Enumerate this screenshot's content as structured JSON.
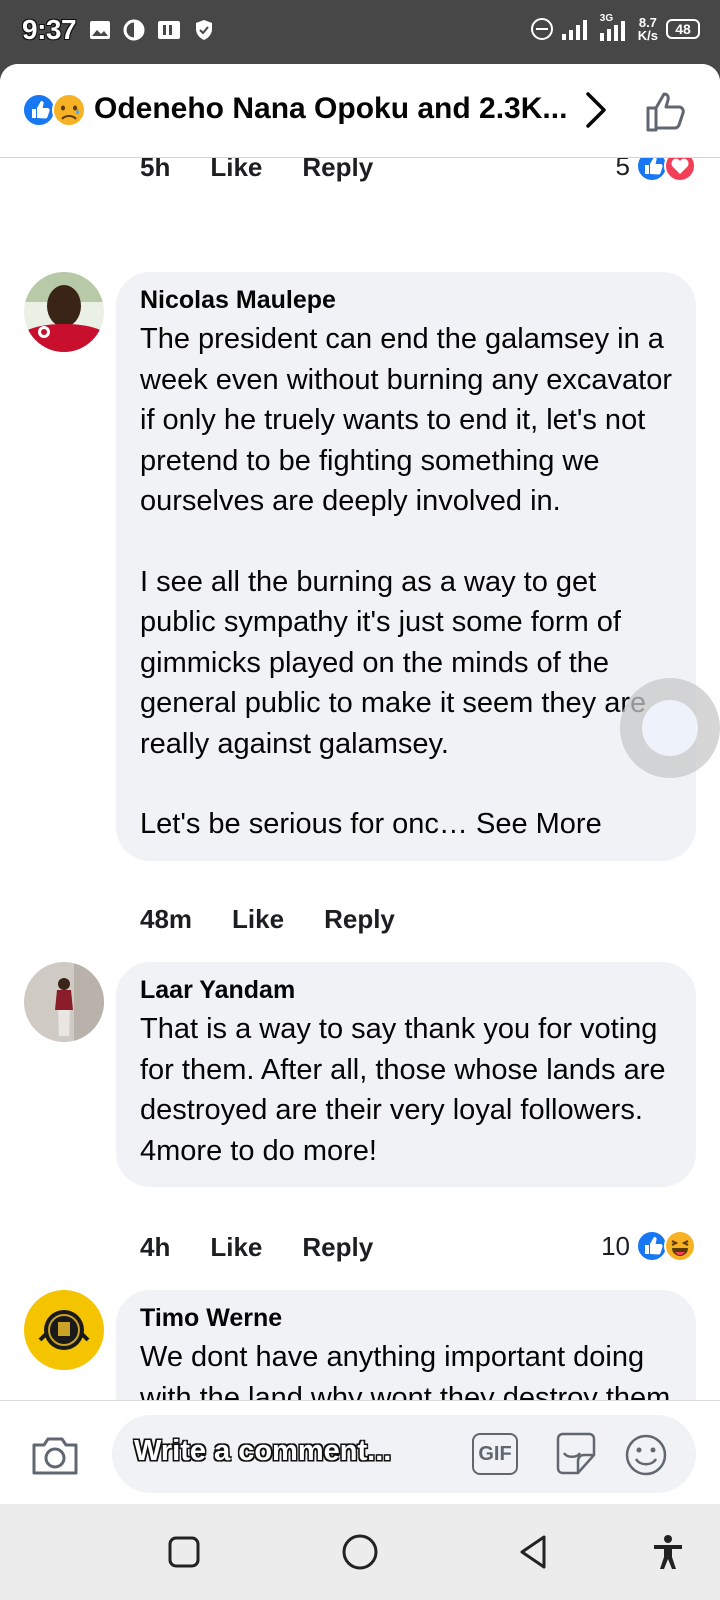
{
  "status_bar": {
    "time": "9:37",
    "network_speed_value": "8.7",
    "network_speed_unit": "K/s",
    "network_type": "3G",
    "battery": "48"
  },
  "header": {
    "title": "Odeneho Nana Opoku and 2.3K..."
  },
  "colors": {
    "fb_blue": "#1877f2",
    "bubble_bg": "#f0f2f5",
    "love_red": "#f33e58"
  },
  "top_meta": {
    "time": "5h",
    "like": "Like",
    "reply": "Reply",
    "reaction_count": "5"
  },
  "comments": [
    {
      "author": "Nicolas Maulepe",
      "paragraphs": [
        "The president can end the galamsey in a week even without burning any excavator if only he truely wants to end it, let's not pretend to be fighting something we ourselves are deeply involved in.",
        "I see all the burning as a way to get public sympathy it's just some form of gimmicks played on the minds of the general public to make it seem they are really against galamsey."
      ],
      "truncated_text": "Let's be serious for onc…",
      "see_more": "See More",
      "time": "48m",
      "like": "Like",
      "reply": "Reply"
    },
    {
      "author": "Laar Yandam",
      "text": "That is a way to say thank you for voting for them. After all, those whose lands are destroyed are their very loyal followers. 4more to do more!",
      "time": "4h",
      "like": "Like",
      "reply": "Reply",
      "reaction_count": "10"
    },
    {
      "author": "Timo Werne",
      "text": "We dont have anything important doing with the land why wont they destroy them the aimless"
    }
  ],
  "composer": {
    "placeholder": "Write a comment...",
    "gif_label": "GIF"
  }
}
